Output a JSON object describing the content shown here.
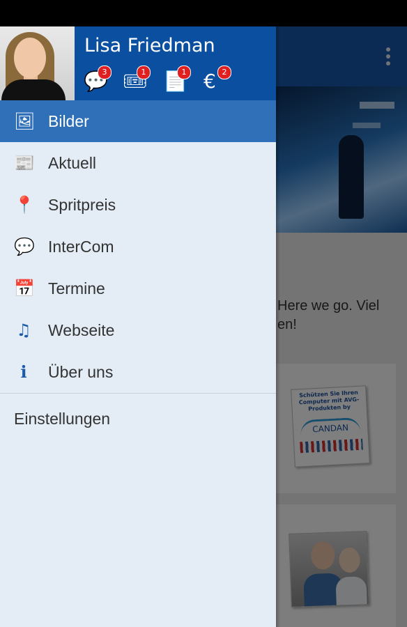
{
  "user": {
    "name": "Lisa Friedman"
  },
  "notifications": [
    {
      "icon": "chat-bubbles-icon",
      "glyph": "💬",
      "count": "3"
    },
    {
      "icon": "tickets-icon",
      "glyph": "🎟",
      "count": "1"
    },
    {
      "icon": "documents-icon",
      "glyph": "📄",
      "count": "1"
    },
    {
      "icon": "euro-icon",
      "glyph": "€",
      "count": "2"
    }
  ],
  "menu": [
    {
      "label": "Bilder",
      "icon": "image-icon",
      "glyph": "🖼",
      "active": true
    },
    {
      "label": "Aktuell",
      "icon": "newspaper-icon",
      "glyph": "📰"
    },
    {
      "label": "Spritpreis",
      "icon": "map-pin-icon",
      "glyph": "📍"
    },
    {
      "label": "InterCom",
      "icon": "chat-icon",
      "glyph": "💬"
    },
    {
      "label": "Termine",
      "icon": "calendar-icon",
      "glyph": "📅"
    },
    {
      "label": "Webseite",
      "icon": "music-note-icon",
      "glyph": "♫"
    },
    {
      "label": "Über uns",
      "icon": "info-icon",
      "glyph": "ℹ"
    }
  ],
  "settings": {
    "label": "Einstellungen"
  },
  "background": {
    "post_text_line1": "Here we go. Viel",
    "post_text_line2": "en!",
    "card1_thumb_text": "Schützen Sie Ihren Computer mit AVG-Produkten by",
    "card1_brand": "CANDAN"
  },
  "colors": {
    "header": "#0b4fa0",
    "active_item": "#2f70b8",
    "drawer_bg": "#e4ecf5",
    "badge": "#e02020"
  }
}
